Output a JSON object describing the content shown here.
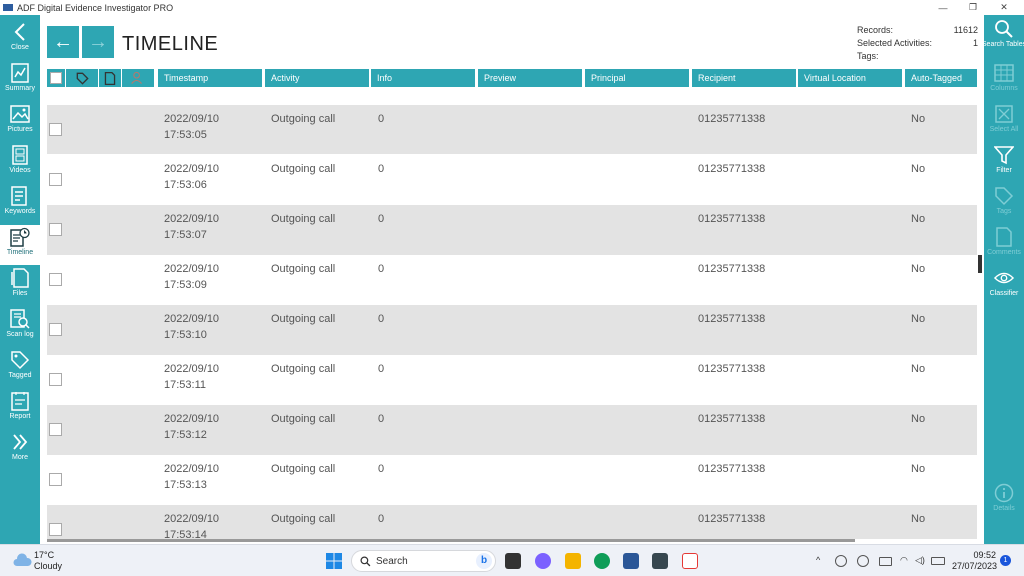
{
  "window": {
    "title": "ADF Digital Evidence Investigator PRO",
    "controls": {
      "minimize": "—",
      "maximize": "❐",
      "close": "✕"
    }
  },
  "left_nav": [
    {
      "label": "Close",
      "icon": "chevron-left-icon"
    },
    {
      "label": "Summary",
      "icon": "summary-icon"
    },
    {
      "label": "Pictures",
      "icon": "pictures-icon"
    },
    {
      "label": "Videos",
      "icon": "videos-icon"
    },
    {
      "label": "Keywords",
      "icon": "keywords-icon"
    },
    {
      "label": "Timeline",
      "icon": "timeline-icon",
      "active": true
    },
    {
      "label": "Files",
      "icon": "files-icon"
    },
    {
      "label": "Scan log",
      "icon": "scan-log-icon"
    },
    {
      "label": "Tagged",
      "icon": "tag-icon"
    },
    {
      "label": "Report",
      "icon": "report-icon"
    },
    {
      "label": "More",
      "icon": "double-chevron-right-icon"
    }
  ],
  "right_nav": [
    {
      "label": "Search Tables",
      "icon": "search-icon",
      "enabled": true
    },
    {
      "label": "Columns",
      "icon": "columns-icon",
      "enabled": false
    },
    {
      "label": "Select All",
      "icon": "select-all-icon",
      "enabled": false
    },
    {
      "label": "Filter",
      "icon": "filter-icon",
      "enabled": true
    },
    {
      "label": "Tags",
      "icon": "tag-icon",
      "enabled": false
    },
    {
      "label": "Comments",
      "icon": "comments-icon",
      "enabled": false
    },
    {
      "label": "Classifier",
      "icon": "eye-icon",
      "enabled": true
    },
    {
      "label": "Details",
      "icon": "info-icon",
      "enabled": false
    }
  ],
  "page": {
    "title": "TIMELINE",
    "back_arrow": "←",
    "forward_arrow": "→"
  },
  "stats": {
    "records_label": "Records:",
    "records_value": "11612",
    "selected_label": "Selected Activities:",
    "selected_value": "1",
    "tags_label": "Tags:",
    "tags_value": ""
  },
  "table": {
    "columns": [
      "Timestamp",
      "Activity",
      "Info",
      "Preview",
      "Principal",
      "Recipient",
      "Virtual Location",
      "Auto-Tagged"
    ],
    "rows": [
      {
        "date": "2022/09/10",
        "time": "17:53:05",
        "activity": "Outgoing call",
        "info": "0",
        "preview": "",
        "principal": "",
        "recipient": "01235771338",
        "virtual_location": "",
        "auto_tagged": "No"
      },
      {
        "date": "2022/09/10",
        "time": "17:53:06",
        "activity": "Outgoing call",
        "info": "0",
        "preview": "",
        "principal": "",
        "recipient": "01235771338",
        "virtual_location": "",
        "auto_tagged": "No"
      },
      {
        "date": "2022/09/10",
        "time": "17:53:07",
        "activity": "Outgoing call",
        "info": "0",
        "preview": "",
        "principal": "",
        "recipient": "01235771338",
        "virtual_location": "",
        "auto_tagged": "No"
      },
      {
        "date": "2022/09/10",
        "time": "17:53:09",
        "activity": "Outgoing call",
        "info": "0",
        "preview": "",
        "principal": "",
        "recipient": "01235771338",
        "virtual_location": "",
        "auto_tagged": "No"
      },
      {
        "date": "2022/09/10",
        "time": "17:53:10",
        "activity": "Outgoing call",
        "info": "0",
        "preview": "",
        "principal": "",
        "recipient": "01235771338",
        "virtual_location": "",
        "auto_tagged": "No"
      },
      {
        "date": "2022/09/10",
        "time": "17:53:11",
        "activity": "Outgoing call",
        "info": "0",
        "preview": "",
        "principal": "",
        "recipient": "01235771338",
        "virtual_location": "",
        "auto_tagged": "No"
      },
      {
        "date": "2022/09/10",
        "time": "17:53:12",
        "activity": "Outgoing call",
        "info": "0",
        "preview": "",
        "principal": "",
        "recipient": "01235771338",
        "virtual_location": "",
        "auto_tagged": "No"
      },
      {
        "date": "2022/09/10",
        "time": "17:53:13",
        "activity": "Outgoing call",
        "info": "0",
        "preview": "",
        "principal": "",
        "recipient": "01235771338",
        "virtual_location": "",
        "auto_tagged": "No"
      },
      {
        "date": "2022/09/10",
        "time": "17:53:14",
        "activity": "Outgoing call",
        "info": "0",
        "preview": "",
        "principal": "",
        "recipient": "01235771338",
        "virtual_location": "",
        "auto_tagged": "No"
      }
    ]
  },
  "taskbar": {
    "weather_temp": "17°C",
    "weather_desc": "Cloudy",
    "search_placeholder": "Search",
    "time": "09:52",
    "date": "27/07/2023",
    "notification_count": "1"
  },
  "colors": {
    "accent": "#2ea6b3",
    "row_alt": "#e3e3e3"
  }
}
